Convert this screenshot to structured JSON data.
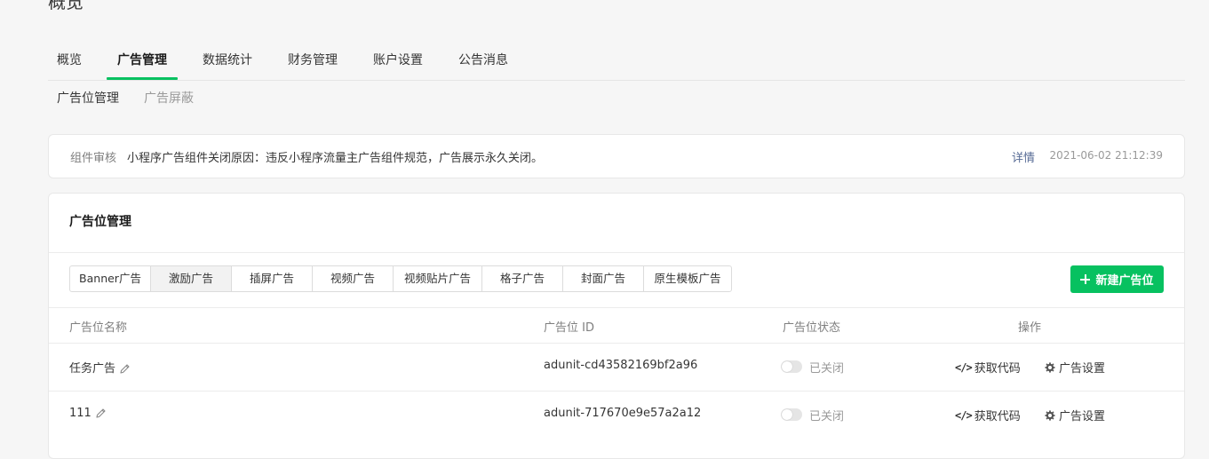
{
  "page": {
    "heading": "概览"
  },
  "main_tabs": [
    {
      "label": "概览",
      "active": false
    },
    {
      "label": "广告管理",
      "active": true
    },
    {
      "label": "数据统计",
      "active": false
    },
    {
      "label": "财务管理",
      "active": false
    },
    {
      "label": "账户设置",
      "active": false
    },
    {
      "label": "公告消息",
      "active": false
    }
  ],
  "sub_tabs": [
    {
      "label": "广告位管理",
      "active": true
    },
    {
      "label": "广告屏蔽",
      "active": false
    }
  ],
  "notice": {
    "label": "组件审核",
    "text": "小程序广告组件关闭原因：违反小程序流量主广告组件规范，广告展示永久关闭。",
    "detail_link": "详情",
    "time": "2021-06-02 21:12:39"
  },
  "card": {
    "title": "广告位管理",
    "ad_types": [
      {
        "label": "Banner广告",
        "active": false
      },
      {
        "label": "激励广告",
        "active": true
      },
      {
        "label": "插屏广告",
        "active": false
      },
      {
        "label": "视频广告",
        "active": false
      },
      {
        "label": "视频贴片广告",
        "active": false
      },
      {
        "label": "格子广告",
        "active": false
      },
      {
        "label": "封面广告",
        "active": false
      },
      {
        "label": "原生模板广告",
        "active": false
      }
    ],
    "new_button": "新建广告位",
    "columns": {
      "name": "广告位名称",
      "id": "广告位 ID",
      "status": "广告位状态",
      "actions": "操作"
    },
    "rows": [
      {
        "name": "任务广告",
        "id": "adunit-cd43582169bf2a96",
        "status": "已关闭",
        "enabled": false,
        "action_code": "获取代码",
        "action_settings": "广告设置"
      },
      {
        "name": "111",
        "id": "adunit-717670e9e57a2a12",
        "status": "已关闭",
        "enabled": false,
        "action_code": "获取代码",
        "action_settings": "广告设置"
      }
    ]
  },
  "colors": {
    "accent": "#07c160",
    "link": "#576b95"
  },
  "icons": {
    "plus": "plus-icon",
    "edit": "pencil-icon",
    "code": "code-icon",
    "settings": "gear-icon"
  }
}
